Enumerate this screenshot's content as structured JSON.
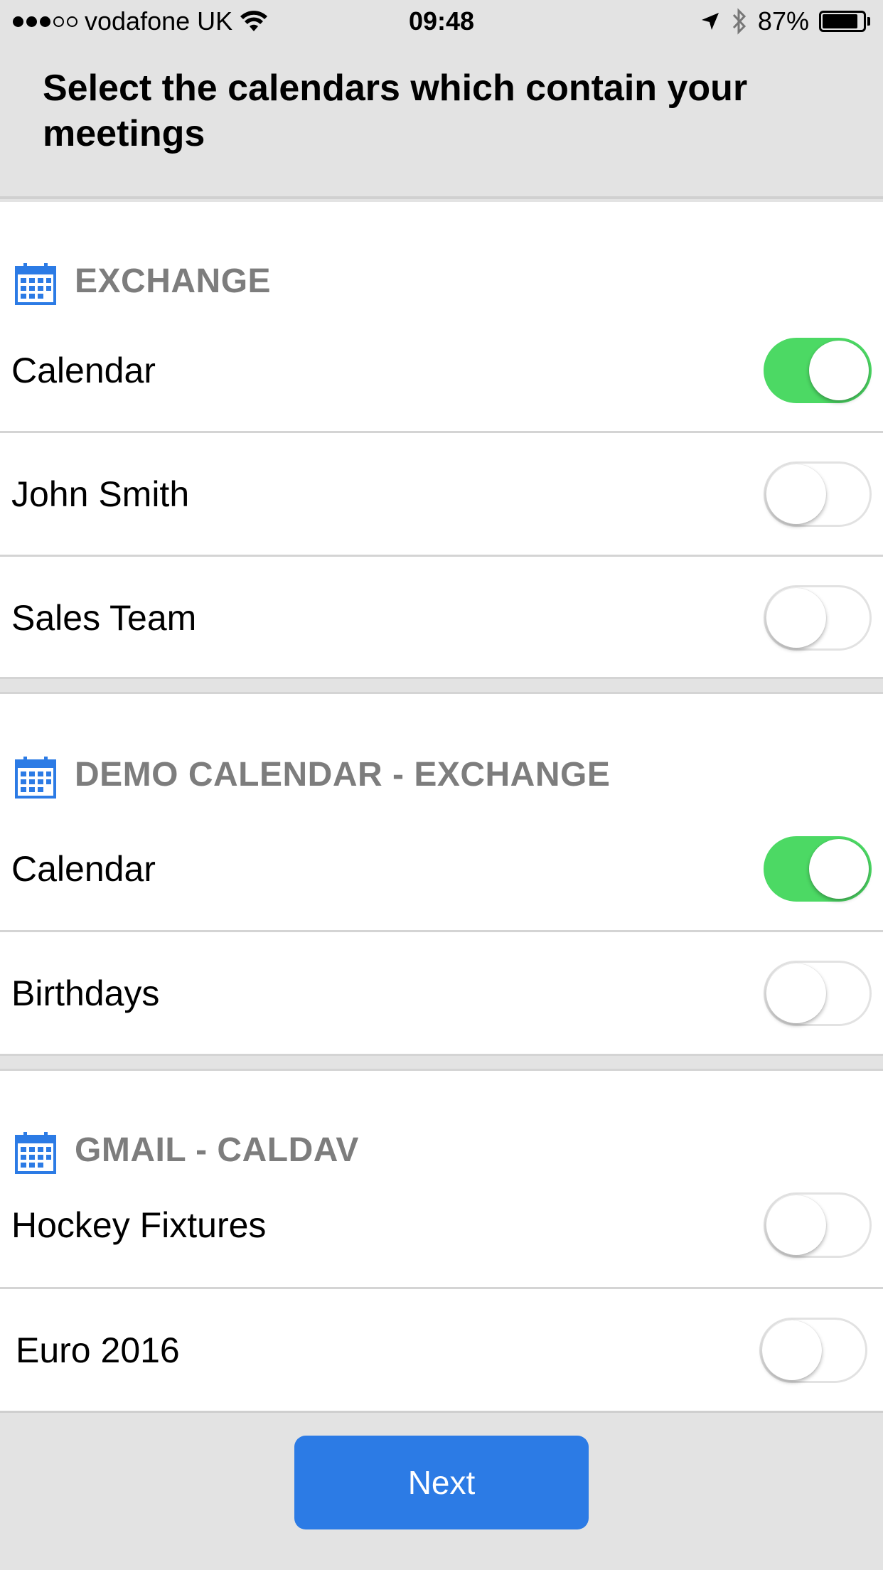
{
  "status_bar": {
    "carrier": "vodafone UK",
    "time": "09:48",
    "battery": "87%",
    "signal_bars": 3,
    "signal_total": 5
  },
  "header": {
    "title": "Select the calendars which contain your meetings"
  },
  "sections": [
    {
      "title": "EXCHANGE",
      "icon": "calendar-icon",
      "items": [
        {
          "label": "Calendar",
          "enabled": true
        },
        {
          "label": "John Smith",
          "enabled": false
        },
        {
          "label": "Sales Team",
          "enabled": false
        }
      ]
    },
    {
      "title": "DEMO CALENDAR - EXCHANGE",
      "icon": "calendar-icon",
      "items": [
        {
          "label": "Calendar",
          "enabled": true
        },
        {
          "label": "Birthdays",
          "enabled": false
        }
      ]
    },
    {
      "title": "GMAIL - CALDAV",
      "icon": "calendar-icon",
      "items": [
        {
          "label": "Hockey Fixtures",
          "enabled": false
        },
        {
          "label": "Euro 2016",
          "enabled": false
        }
      ]
    }
  ],
  "footer": {
    "next_label": "Next"
  },
  "colors": {
    "toggle_on": "#4cd964",
    "accent_blue": "#2c7be5",
    "section_title": "#7d7d7d"
  }
}
